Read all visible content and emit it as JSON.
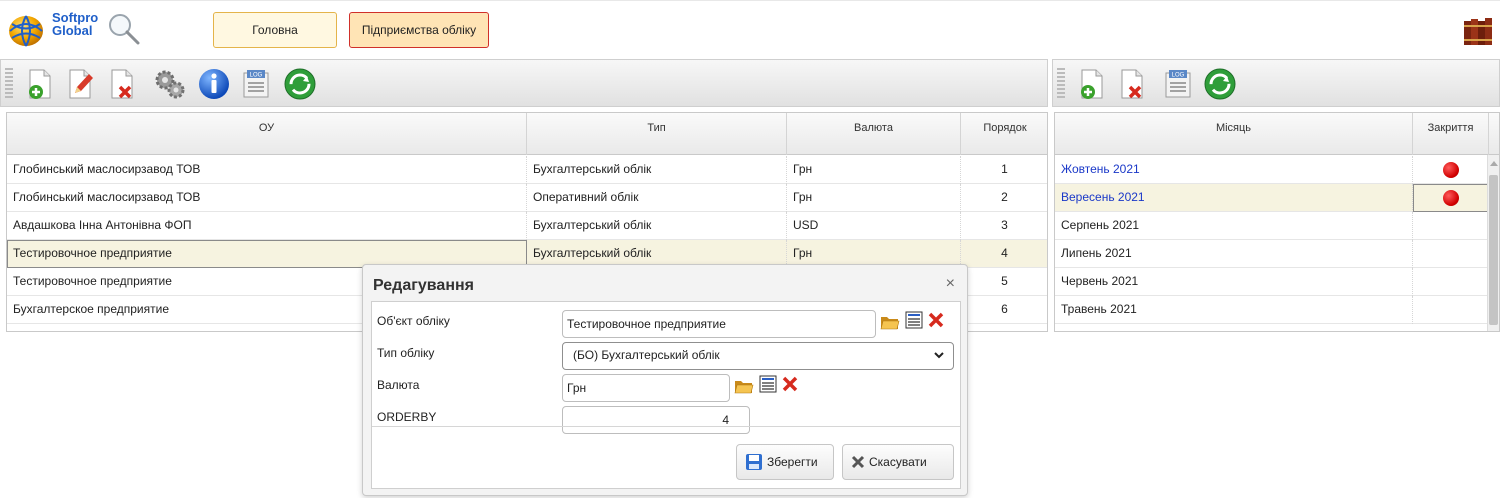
{
  "header": {
    "logo_line1": "Softpro",
    "logo_line2": "Global",
    "home_label": "Головна",
    "enterprises_label": "Підприємства обліку"
  },
  "grid_left": {
    "columns": [
      "ОУ",
      "Тип",
      "Валюта",
      "Порядок"
    ],
    "rows": [
      {
        "ou": "Глобинський маслосирзавод ТОВ",
        "type": "Бухгалтерський облік",
        "currency": "Грн",
        "order": "1"
      },
      {
        "ou": "Глобинський маслосирзавод ТОВ",
        "type": "Оперативний облік",
        "currency": "Грн",
        "order": "2"
      },
      {
        "ou": "Авдашкова Інна Антонівна ФОП",
        "type": "Бухгалтерський облік",
        "currency": "USD",
        "order": "3"
      },
      {
        "ou": "Тестировочное предприятие",
        "type": "Бухгалтерський облік",
        "currency": "Грн",
        "order": "4"
      },
      {
        "ou": "Тестировочное предприятие",
        "type": "",
        "currency": "",
        "order": "5"
      },
      {
        "ou": "Бухгалтерское предприятие",
        "type": "",
        "currency": "",
        "order": "6"
      }
    ]
  },
  "grid_right": {
    "columns": [
      "Місяць",
      "Закриття"
    ],
    "rows": [
      {
        "month": "Жовтень 2021",
        "closed": true
      },
      {
        "month": "Вересень 2021",
        "closed": true
      },
      {
        "month": "Серпень 2021",
        "closed": false
      },
      {
        "month": "Липень 2021",
        "closed": false
      },
      {
        "month": "Червень 2021",
        "closed": false
      },
      {
        "month": "Травень 2021",
        "closed": false
      }
    ]
  },
  "dialog": {
    "title": "Редагування",
    "close_glyph": "×",
    "fields": {
      "object_label": "Об'єкт обліку",
      "object_value": "Тестировочное предприятие",
      "type_label": "Тип обліку",
      "type_value": "(БО) Бухгалтерський облік",
      "currency_label": "Валюта",
      "currency_value": "Грн",
      "orderby_label": "ORDERBY",
      "orderby_value": "4"
    },
    "save_label": "Зберегти",
    "cancel_label": "Скасувати"
  },
  "colors": {
    "link": "#1a38c8",
    "closed_dot": "#d10000",
    "selected_row": "#f6f3e0",
    "home_button_border": "#e4b44a",
    "active_button_border": "#d0302a"
  },
  "icons": {
    "left_toolbar": [
      "add-document-icon",
      "edit-document-icon",
      "delete-document-icon",
      "settings-gears-icon",
      "info-icon",
      "log-icon",
      "refresh-icon"
    ],
    "right_toolbar": [
      "add-document-icon",
      "delete-document-icon",
      "log-icon",
      "refresh-icon"
    ]
  }
}
